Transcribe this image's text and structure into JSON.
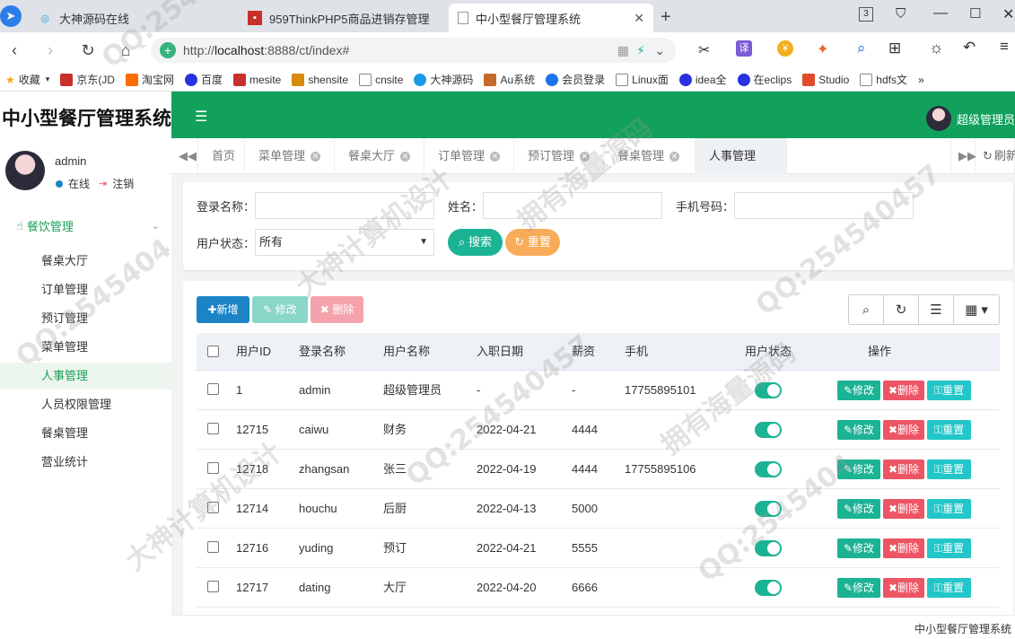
{
  "browser": {
    "tabs": [
      {
        "title": "大神源码在线",
        "active": false
      },
      {
        "title": "959ThinkPHP5商品进销存管理",
        "active": false
      },
      {
        "title": "中小型餐厅管理系统",
        "active": true
      }
    ],
    "new_tab": "+",
    "url_host": "localhost",
    "url_prefix": "http://",
    "url_rest": ":8888/ct/index#",
    "bookmarks": [
      "收藏",
      "京东(JD",
      "淘宝网",
      "百度",
      "mesite",
      "shensite",
      "cnsite",
      "大神源码",
      "Au系统",
      "会员登录",
      "Linux面",
      "idea全",
      "在eclips",
      "Studio",
      "hdfs文"
    ],
    "more": "»",
    "tab_counter": "3"
  },
  "app": {
    "brand": "中小型餐厅管理系统",
    "top_user": "超级管理员",
    "sidebar": {
      "username": "admin",
      "status": "在线",
      "logout": "注销",
      "group": "餐饮管理",
      "items": [
        "餐桌大厅",
        "订单管理",
        "预订管理",
        "菜单管理",
        "人事管理",
        "人员权限管理",
        "餐桌管理",
        "营业统计"
      ],
      "active_index": 4
    },
    "page_tabs": [
      "首页",
      "菜单管理",
      "餐桌大厅",
      "订单管理",
      "预订管理",
      "餐桌管理",
      "人事管理"
    ],
    "refresh": "刷新",
    "search": {
      "login_label": "登录名称：",
      "name_label": "姓名：",
      "phone_label": "手机号码：",
      "status_label": "用户状态：",
      "status_value": "所有",
      "search_btn": "搜索",
      "reset_btn": "重置"
    },
    "toolbar": {
      "add": "新增",
      "edit": "修改",
      "delete": "删除"
    },
    "columns": [
      "用户ID",
      "登录名称",
      "用户名称",
      "入职日期",
      "薪资",
      "手机",
      "用户状态",
      "操作"
    ],
    "rows": [
      {
        "id": "1",
        "login": "admin",
        "name": "超级管理员",
        "date": "-",
        "salary": "-",
        "phone": "17755895101"
      },
      {
        "id": "12715",
        "login": "caiwu",
        "name": "财务",
        "date": "2022-04-21",
        "salary": "4444",
        "phone": ""
      },
      {
        "id": "12718",
        "login": "zhangsan",
        "name": "张三",
        "date": "2022-04-19",
        "salary": "4444",
        "phone": "17755895106"
      },
      {
        "id": "12714",
        "login": "houchu",
        "name": "后厨",
        "date": "2022-04-13",
        "salary": "5000",
        "phone": ""
      },
      {
        "id": "12716",
        "login": "yuding",
        "name": "预订",
        "date": "2022-04-21",
        "salary": "5555",
        "phone": ""
      },
      {
        "id": "12717",
        "login": "dating",
        "name": "大厅",
        "date": "2022-04-20",
        "salary": "6666",
        "phone": ""
      }
    ],
    "row_actions": {
      "edit": "修改",
      "delete": "删除",
      "reset": "重置"
    },
    "footer": "中小型餐厅管理系统"
  },
  "watermarks": [
    "QQ:25454",
    "大神计算机设计",
    "拥有海量源码",
    "QQ:2545404",
    "QQ:254540457"
  ],
  "colors": {
    "green": "#12a15c",
    "teal": "#1bb394",
    "blue": "#1c84c6",
    "red": "#ed5565",
    "orange": "#f8ac59",
    "cyan": "#23c6c8"
  }
}
